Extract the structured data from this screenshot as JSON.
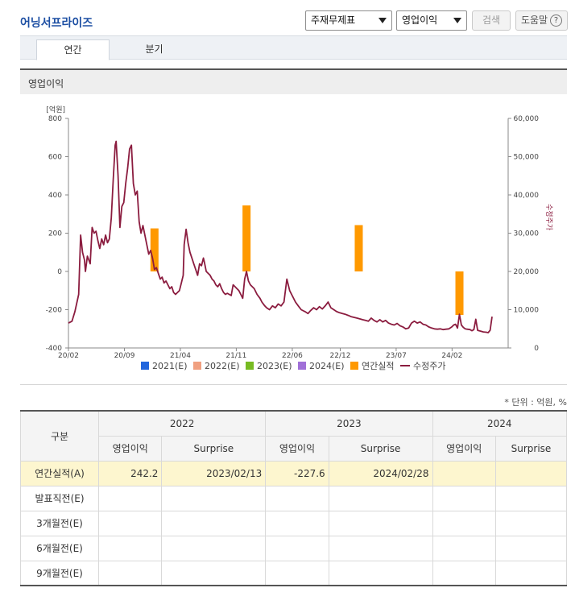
{
  "header": {
    "title": "어닝서프라이즈",
    "select_type": "주재무제표",
    "select_metric": "영업이익",
    "search_label": "검색",
    "help_label": "도움말",
    "help_icon_glyph": "?"
  },
  "tabs": [
    {
      "label": "연간",
      "active": true
    },
    {
      "label": "분기",
      "active": false
    }
  ],
  "section_title": "영업이익",
  "chart_data": {
    "type": "bar+line",
    "left_axis": {
      "unit": "[억원]",
      "min": -400,
      "max": 800,
      "ticks": [
        "800",
        "600",
        "400",
        "200",
        "0",
        "-200",
        "-400"
      ]
    },
    "right_axis": {
      "label": "수정주가",
      "min": 0,
      "max": 60000,
      "ticks": [
        "60,000",
        "50,000",
        "40,000",
        "30,000",
        "20,000",
        "10,000",
        "0"
      ]
    },
    "x_ticks": [
      "20/02",
      "20/09",
      "21/04",
      "21/11",
      "22/06",
      "22/12",
      "23/07",
      "24/02"
    ],
    "x_range": [
      2020.083,
      2024.5
    ],
    "bars": [
      {
        "x": 2020.98,
        "value": 225
      },
      {
        "x": 2021.94,
        "value": 345
      },
      {
        "x": 2023.11,
        "value": 242.2
      },
      {
        "x": 2024.16,
        "value": -227.6
      }
    ],
    "bar_color": "#ff9900",
    "line_color": "#8b1c3f",
    "price_series": [
      [
        2020.083,
        6500
      ],
      [
        2020.12,
        7000
      ],
      [
        2020.15,
        9500
      ],
      [
        2020.19,
        14000
      ],
      [
        2020.21,
        29500
      ],
      [
        2020.23,
        25000
      ],
      [
        2020.25,
        23000
      ],
      [
        2020.26,
        20000
      ],
      [
        2020.28,
        24000
      ],
      [
        2020.31,
        22000
      ],
      [
        2020.33,
        31500
      ],
      [
        2020.35,
        30000
      ],
      [
        2020.37,
        30500
      ],
      [
        2020.39,
        28000
      ],
      [
        2020.41,
        26000
      ],
      [
        2020.43,
        28500
      ],
      [
        2020.45,
        27000
      ],
      [
        2020.47,
        29500
      ],
      [
        2020.49,
        27500
      ],
      [
        2020.51,
        28500
      ],
      [
        2020.53,
        34000
      ],
      [
        2020.55,
        44000
      ],
      [
        2020.57,
        53000
      ],
      [
        2020.58,
        54000
      ],
      [
        2020.6,
        45000
      ],
      [
        2020.62,
        31500
      ],
      [
        2020.64,
        37000
      ],
      [
        2020.66,
        38000
      ],
      [
        2020.68,
        43000
      ],
      [
        2020.7,
        47000
      ],
      [
        2020.72,
        52000
      ],
      [
        2020.74,
        53000
      ],
      [
        2020.76,
        43000
      ],
      [
        2020.78,
        40000
      ],
      [
        2020.8,
        41000
      ],
      [
        2020.82,
        33000
      ],
      [
        2020.84,
        30000
      ],
      [
        2020.86,
        32000
      ],
      [
        2020.88,
        29500
      ],
      [
        2020.9,
        27000
      ],
      [
        2020.92,
        24500
      ],
      [
        2020.94,
        25500
      ],
      [
        2020.96,
        23500
      ],
      [
        2020.98,
        20500
      ],
      [
        2021.0,
        21000
      ],
      [
        2021.02,
        19500
      ],
      [
        2021.04,
        18000
      ],
      [
        2021.06,
        18500
      ],
      [
        2021.08,
        17000
      ],
      [
        2021.1,
        17500
      ],
      [
        2021.12,
        16500
      ],
      [
        2021.14,
        15500
      ],
      [
        2021.16,
        16000
      ],
      [
        2021.18,
        14500
      ],
      [
        2021.2,
        14000
      ],
      [
        2021.22,
        14500
      ],
      [
        2021.24,
        15000
      ],
      [
        2021.26,
        17000
      ],
      [
        2021.28,
        19000
      ],
      [
        2021.29,
        27000
      ],
      [
        2021.31,
        31000
      ],
      [
        2021.33,
        27500
      ],
      [
        2021.35,
        25000
      ],
      [
        2021.37,
        23500
      ],
      [
        2021.39,
        22000
      ],
      [
        2021.41,
        20500
      ],
      [
        2021.43,
        19000
      ],
      [
        2021.45,
        22000
      ],
      [
        2021.47,
        21500
      ],
      [
        2021.49,
        23500
      ],
      [
        2021.5,
        22500
      ],
      [
        2021.52,
        20000
      ],
      [
        2021.54,
        19500
      ],
      [
        2021.56,
        19000
      ],
      [
        2021.58,
        18000
      ],
      [
        2021.6,
        17500
      ],
      [
        2021.62,
        16500
      ],
      [
        2021.64,
        16000
      ],
      [
        2021.66,
        16800
      ],
      [
        2021.68,
        15500
      ],
      [
        2021.7,
        14500
      ],
      [
        2021.72,
        14000
      ],
      [
        2021.74,
        14300
      ],
      [
        2021.76,
        14000
      ],
      [
        2021.78,
        13700
      ],
      [
        2021.8,
        16500
      ],
      [
        2021.82,
        16000
      ],
      [
        2021.84,
        15500
      ],
      [
        2021.86,
        15000
      ],
      [
        2021.88,
        14000
      ],
      [
        2021.9,
        13000
      ],
      [
        2021.92,
        18000
      ],
      [
        2021.94,
        20000
      ],
      [
        2021.96,
        17500
      ],
      [
        2021.98,
        16500
      ],
      [
        2022.0,
        16000
      ],
      [
        2022.02,
        15500
      ],
      [
        2022.05,
        14000
      ],
      [
        2022.08,
        13000
      ],
      [
        2022.1,
        12000
      ],
      [
        2022.13,
        11000
      ],
      [
        2022.15,
        10500
      ],
      [
        2022.18,
        10000
      ],
      [
        2022.21,
        11000
      ],
      [
        2022.24,
        10500
      ],
      [
        2022.27,
        11500
      ],
      [
        2022.3,
        11000
      ],
      [
        2022.33,
        12000
      ],
      [
        2022.36,
        18000
      ],
      [
        2022.39,
        15000
      ],
      [
        2022.42,
        13500
      ],
      [
        2022.45,
        12000
      ],
      [
        2022.48,
        11000
      ],
      [
        2022.51,
        10000
      ],
      [
        2022.55,
        9500
      ],
      [
        2022.58,
        9000
      ],
      [
        2022.61,
        9800
      ],
      [
        2022.64,
        10500
      ],
      [
        2022.67,
        10000
      ],
      [
        2022.7,
        10800
      ],
      [
        2022.73,
        10200
      ],
      [
        2022.76,
        11000
      ],
      [
        2022.79,
        12000
      ],
      [
        2022.82,
        10500
      ],
      [
        2022.85,
        10000
      ],
      [
        2022.88,
        9500
      ],
      [
        2022.91,
        9200
      ],
      [
        2022.94,
        9000
      ],
      [
        2022.97,
        8800
      ],
      [
        2023.0,
        8500
      ],
      [
        2023.03,
        8200
      ],
      [
        2023.06,
        8000
      ],
      [
        2023.09,
        7800
      ],
      [
        2023.12,
        7600
      ],
      [
        2023.15,
        7400
      ],
      [
        2023.18,
        7200
      ],
      [
        2023.21,
        7000
      ],
      [
        2023.24,
        7800
      ],
      [
        2023.27,
        7200
      ],
      [
        2023.3,
        6800
      ],
      [
        2023.33,
        7400
      ],
      [
        2023.36,
        6800
      ],
      [
        2023.39,
        7200
      ],
      [
        2023.42,
        6500
      ],
      [
        2023.45,
        6200
      ],
      [
        2023.48,
        6000
      ],
      [
        2023.51,
        6400
      ],
      [
        2023.54,
        5800
      ],
      [
        2023.57,
        5500
      ],
      [
        2023.6,
        5000
      ],
      [
        2023.63,
        5200
      ],
      [
        2023.66,
        6500
      ],
      [
        2023.69,
        7000
      ],
      [
        2023.72,
        6500
      ],
      [
        2023.75,
        6800
      ],
      [
        2023.78,
        6200
      ],
      [
        2023.81,
        6000
      ],
      [
        2023.84,
        5500
      ],
      [
        2023.87,
        5200
      ],
      [
        2023.9,
        5000
      ],
      [
        2023.93,
        4900
      ],
      [
        2023.96,
        5000
      ],
      [
        2023.99,
        4800
      ],
      [
        2024.02,
        4900
      ],
      [
        2024.05,
        5000
      ],
      [
        2024.08,
        5500
      ],
      [
        2024.1,
        6000
      ],
      [
        2024.12,
        6200
      ],
      [
        2024.14,
        5200
      ],
      [
        2024.16,
        8800
      ],
      [
        2024.18,
        6000
      ],
      [
        2024.2,
        5400
      ],
      [
        2024.22,
        5000
      ],
      [
        2024.24,
        4900
      ],
      [
        2024.27,
        4800
      ],
      [
        2024.29,
        4500
      ],
      [
        2024.31,
        4800
      ],
      [
        2024.33,
        7500
      ],
      [
        2024.35,
        4600
      ],
      [
        2024.38,
        4400
      ],
      [
        2024.41,
        4200
      ],
      [
        2024.44,
        4100
      ],
      [
        2024.46,
        4000
      ],
      [
        2024.48,
        4600
      ],
      [
        2024.5,
        8200
      ]
    ],
    "legend": [
      {
        "label": "2021(E)",
        "color": "#2266dd",
        "kind": "box"
      },
      {
        "label": "2022(E)",
        "color": "#f0a080",
        "kind": "box"
      },
      {
        "label": "2023(E)",
        "color": "#77bb22",
        "kind": "box"
      },
      {
        "label": "2024(E)",
        "color": "#a070d8",
        "kind": "box"
      },
      {
        "label": "연간실적",
        "color": "#ff9900",
        "kind": "box"
      },
      {
        "label": "수정주가",
        "color": "#8b1c3f",
        "kind": "line"
      }
    ]
  },
  "unit_note": "* 단위 : 억원, %",
  "table": {
    "row_header_label": "구분",
    "years": [
      "2022",
      "2023",
      "2024"
    ],
    "sub_headers": [
      "영업이익",
      "Surprise"
    ],
    "rows": [
      {
        "label": "연간실적(A)",
        "cells": [
          "242.2",
          "2023/02/13",
          "-227.6",
          "2024/02/28",
          "",
          ""
        ],
        "highlight": true
      },
      {
        "label": "발표직전(E)",
        "cells": [
          "",
          "",
          "",
          "",
          "",
          ""
        ],
        "highlight": false
      },
      {
        "label": "3개월전(E)",
        "cells": [
          "",
          "",
          "",
          "",
          "",
          ""
        ],
        "highlight": false
      },
      {
        "label": "6개월전(E)",
        "cells": [
          "",
          "",
          "",
          "",
          "",
          ""
        ],
        "highlight": false
      },
      {
        "label": "9개월전(E)",
        "cells": [
          "",
          "",
          "",
          "",
          "",
          ""
        ],
        "highlight": false
      }
    ]
  }
}
